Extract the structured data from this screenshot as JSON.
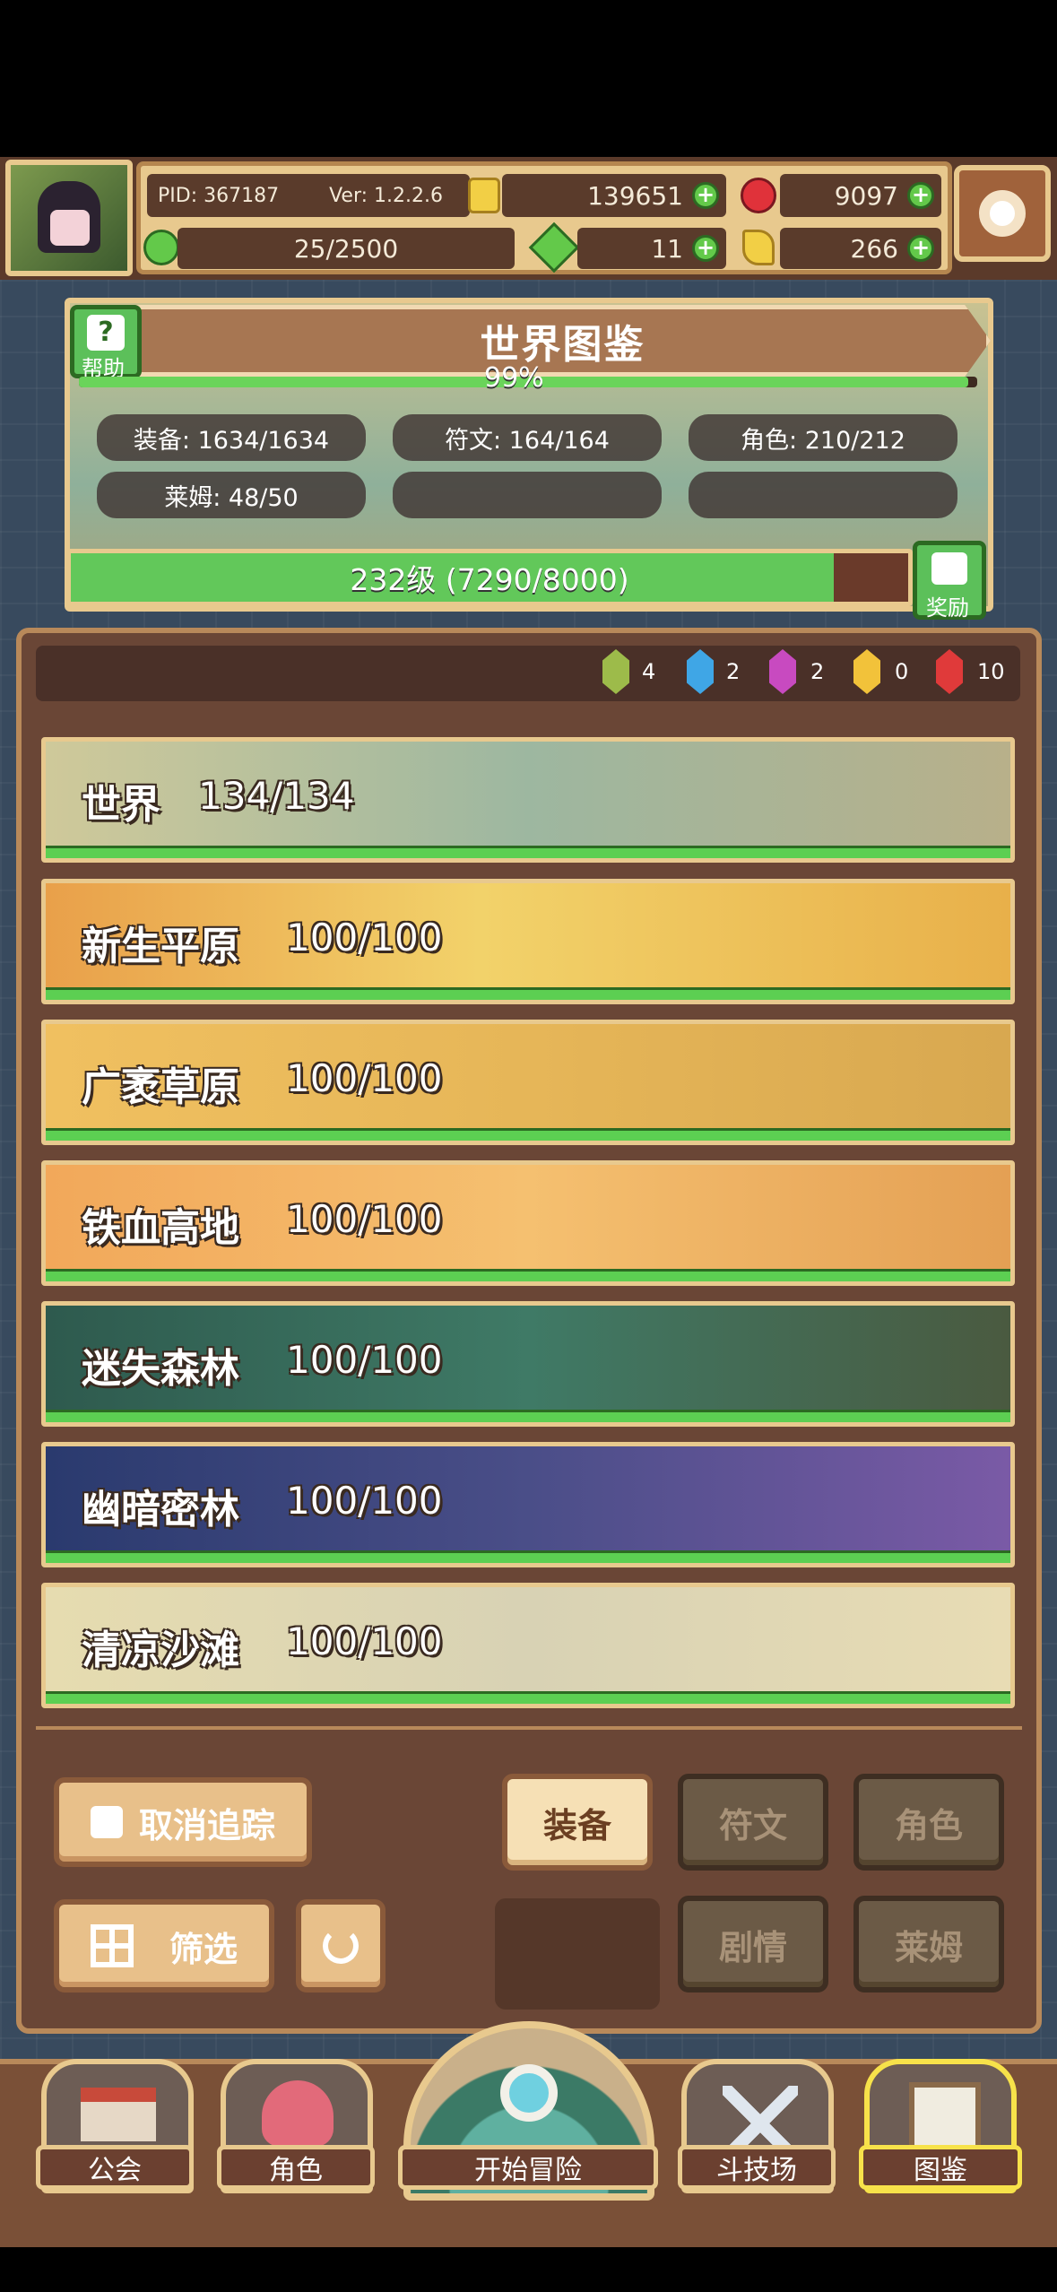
{
  "player": {
    "pid": "PID: 367187",
    "version": "Ver: 1.2.2.6",
    "gold": "139651",
    "gems": "9097",
    "stamina": "25/2500",
    "clover": "11",
    "key": "266"
  },
  "world": {
    "title": "世界图鉴",
    "help_label": "帮助",
    "progress_pct": "99%",
    "progress_value": 0.99,
    "stats": [
      "装备: 1634/1634",
      "符文: 164/164",
      "角色: 210/212",
      "莱姆: 48/50"
    ],
    "level_text": "232级 (7290/8000)",
    "level_fraction": 0.911,
    "reward_label": "奖励"
  },
  "gems_row": {
    "green": "4",
    "blue": "2",
    "purple": "2",
    "yellow": "0",
    "red": "10"
  },
  "regions": [
    {
      "name": "世界",
      "count": "134/134"
    },
    {
      "name": "新生平原",
      "count": "100/100"
    },
    {
      "name": "广袤草原",
      "count": "100/100"
    },
    {
      "name": "铁血高地",
      "count": "100/100"
    },
    {
      "name": "迷失森林",
      "count": "100/100"
    },
    {
      "name": "幽暗密林",
      "count": "100/100"
    },
    {
      "name": "清凉沙滩",
      "count": "100/100"
    }
  ],
  "controls": {
    "untrack": "取消追踪",
    "filter": "筛选",
    "tabs": [
      "装备",
      "符文",
      "角色",
      "剧情",
      "莱姆"
    ]
  },
  "nav": {
    "guild": "公会",
    "character": "角色",
    "adventure": "开始冒险",
    "arena": "斗技场",
    "codex": "图鉴"
  },
  "colors": {
    "accent_green": "#5ccf52",
    "frame_gold": "#e8c98e",
    "panel_brown": "#6a4636"
  }
}
